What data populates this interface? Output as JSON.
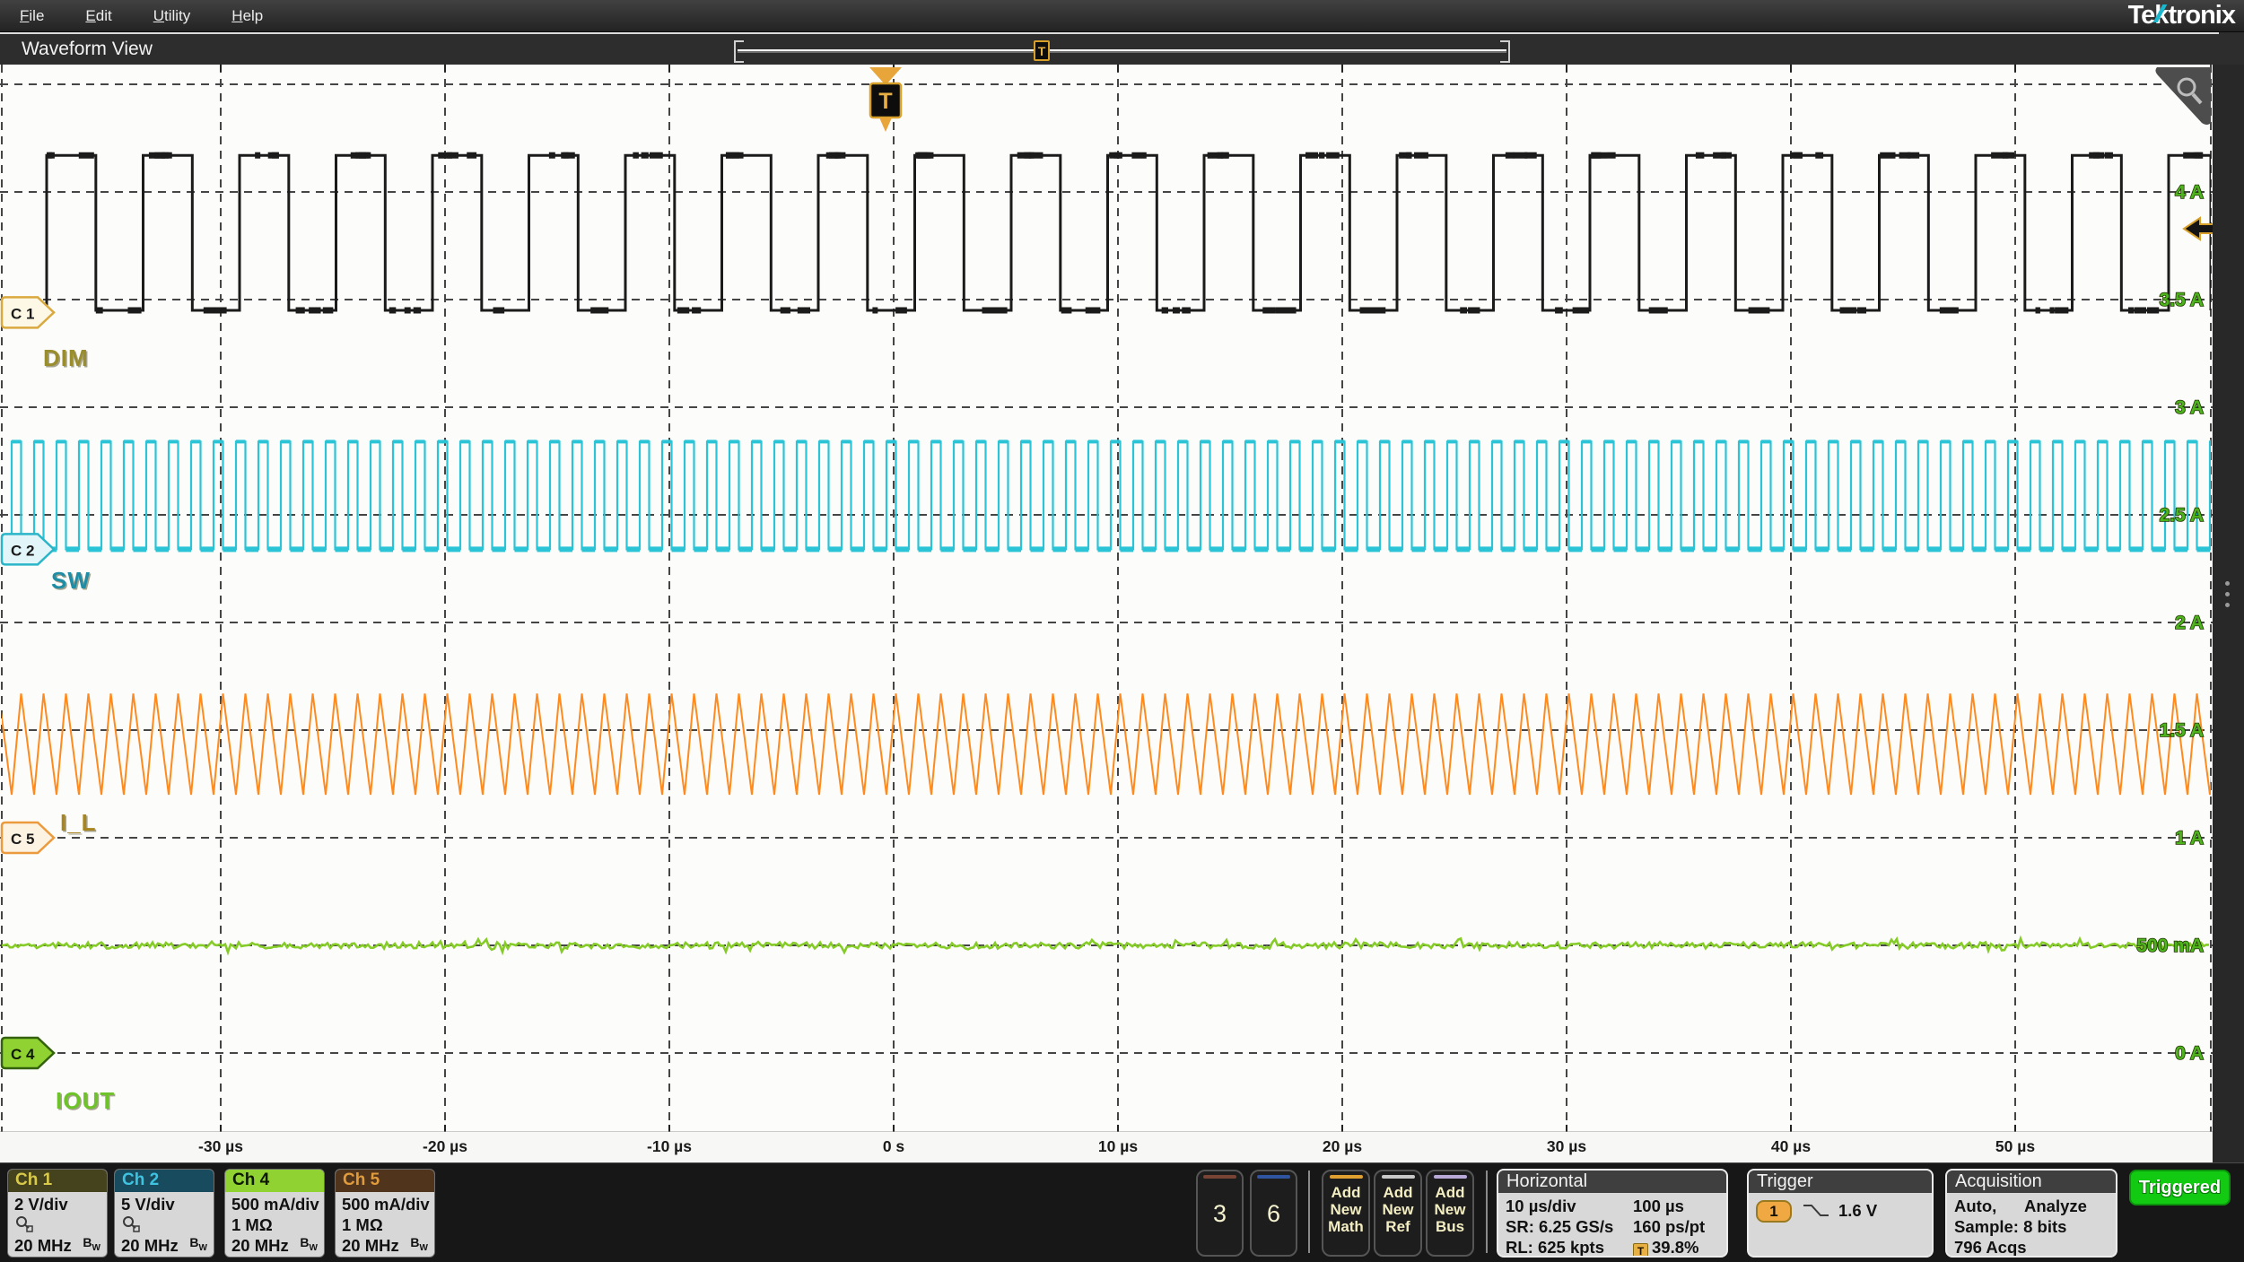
{
  "menu": {
    "items": [
      "File",
      "Edit",
      "Utility",
      "Help"
    ]
  },
  "brand": {
    "pre": "Te",
    "k": "k",
    "post": "tronix"
  },
  "tab": {
    "title": "Waveform View"
  },
  "overview_bar": {
    "trigger_marker": "T",
    "trigger_pos_pct": 39.8
  },
  "graticule": {
    "y_labels": [
      "4 A",
      "3.5 A",
      "3 A",
      "2.5 A",
      "2 A",
      "1.5 A",
      "1 A",
      "500 mA",
      "0 A"
    ],
    "x_labels": [
      "-30 µs",
      "-20 µs",
      "-10 µs",
      "0 s",
      "10 µs",
      "20 µs",
      "30 µs",
      "40 µs",
      "50 µs"
    ],
    "y_label_color": "#4db41e",
    "trigger_marker": "T"
  },
  "channel_markers": [
    {
      "id": "C 1",
      "name": "DIM",
      "level_A": 3.44,
      "fill": "#fdf8e6",
      "stroke": "#d9a93f",
      "text": "#1a1a1a",
      "label_color": "#9a8d2e"
    },
    {
      "id": "C 2",
      "name": "SW",
      "level_A": 2.34,
      "fill": "#e2f6fa",
      "stroke": "#2ab5c8",
      "text": "#1a1a1a",
      "label_color": "#1f8da6"
    },
    {
      "id": "C 5",
      "name": "I_L",
      "level_A": 1.0,
      "fill": "#fdf3e2",
      "stroke": "#ec9a3e",
      "text": "#1a1a1a",
      "label_color": "#a8851f"
    },
    {
      "id": "C 4",
      "name": "IOUT",
      "level_A": 0.0,
      "fill": "#8fd232",
      "stroke": "#33610e",
      "text": "#0d1a00",
      "label_color": "#6fc32a"
    }
  ],
  "chart_data": {
    "type": "line",
    "title": "LED driver switching waveforms",
    "x_axis": {
      "unit": "µs",
      "per_div": 10,
      "window_us": 100,
      "visible_range_us": [
        -39.8,
        58.8
      ]
    },
    "y_axis": {
      "unit": "A",
      "per_div": 0.5,
      "labels_top_to_bottom": [
        "4 A",
        "3.5 A",
        "3 A",
        "2.5 A",
        "2 A",
        "1.5 A",
        "1 A",
        "500 mA",
        "0 A"
      ]
    },
    "series": [
      {
        "name": "DIM",
        "channel": "C1",
        "color": "#1b1b1b",
        "shape": "square",
        "period_us": 4.3,
        "duty": 0.51,
        "first_rise_us": -37.76,
        "high_A": 4.17,
        "low_A": 3.45,
        "noisy_levels": true
      },
      {
        "name": "SW",
        "channel": "C2",
        "color": "#2bc4d6",
        "shape": "square",
        "period_us": 1.0,
        "duty": 0.42,
        "first_rise_us": -39.32,
        "high_A": 2.84,
        "low_A": 2.34,
        "thick_baseline": true
      },
      {
        "name": "I_L",
        "channel": "C5",
        "color": "#ff8a1e",
        "shape": "triangle",
        "period_us": 1.0,
        "trough_us": -39.32,
        "rise_frac": 0.42,
        "max_A": 1.67,
        "min_A": 1.2
      },
      {
        "name": "IOUT",
        "channel": "C4",
        "color": "#86cc28",
        "shape": "noisy-flat",
        "level_A": 0.5,
        "noise_A": 0.02
      }
    ]
  },
  "channels": [
    {
      "name": "Ch 1",
      "scale": "2 V/div",
      "row2": "probe",
      "impedance": "",
      "bandwidth": "20 MHz",
      "bw_b": "B",
      "bw_w": "W",
      "header_bg": "#45431d",
      "header_fg": "#d9c94b"
    },
    {
      "name": "Ch 2",
      "scale": "5 V/div",
      "row2": "probe",
      "impedance": "",
      "bandwidth": "20 MHz",
      "bw_b": "B",
      "bw_w": "W",
      "header_bg": "#174b5d",
      "header_fg": "#3ec3e0"
    },
    {
      "name": "Ch 4",
      "scale": "500 mA/div",
      "row2": "text",
      "impedance": "1 MΩ",
      "bandwidth": "20 MHz",
      "bw_b": "B",
      "bw_w": "W",
      "header_bg": "#8fd232",
      "header_fg": "#0d1a00"
    },
    {
      "name": "Ch 5",
      "scale": "500 mA/div",
      "row2": "text",
      "impedance": "1 MΩ",
      "bandwidth": "20 MHz",
      "bw_b": "B",
      "bw_w": "W",
      "header_bg": "#50341c",
      "header_fg": "#e09b3d"
    }
  ],
  "inactive_channels": [
    {
      "label": "3",
      "stripe": "#7a4434"
    },
    {
      "label": "6",
      "stripe": "#2f55a0"
    }
  ],
  "add_buttons": [
    {
      "label": "Add New Math",
      "stripe": "#e0a030"
    },
    {
      "label": "Add New Ref",
      "stripe": "#c9c9c9"
    },
    {
      "label": "Add New Bus",
      "stripe": "#b9a9d9"
    }
  ],
  "horizontal": {
    "title": "Horizontal",
    "scale": "10 µs/div",
    "window": "100 µs",
    "sample_rate": "SR: 6.25 GS/s",
    "resolution": "160 ps/pt",
    "record_length": "RL: 625 kpts",
    "position": "39.8%",
    "position_icon": "T"
  },
  "trigger": {
    "title": "Trigger",
    "source": "1",
    "slope": "falling",
    "level": "1.6 V"
  },
  "acquisition": {
    "title": "Acquisition",
    "mode": "Auto,",
    "analyze": "Analyze",
    "sample": "Sample: 8 bits",
    "acqs": "796 Acqs"
  },
  "triggered": {
    "label": "Triggered",
    "color": "#12ca12"
  }
}
